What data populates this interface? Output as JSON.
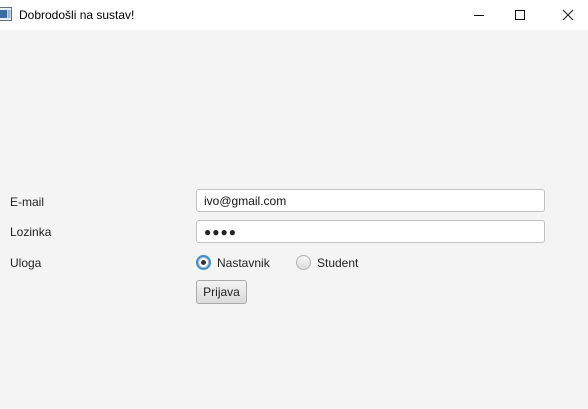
{
  "window": {
    "title": "Dobrodošli na sustav!",
    "controls": {
      "minimize_icon": "minimize-icon",
      "maximize_icon": "maximize-icon",
      "close_icon": "close-icon"
    }
  },
  "form": {
    "email_label": "E-mail",
    "email_value": "ivo@gmail.com",
    "password_label": "Lozinka",
    "password_mask": "●●●●",
    "role_label": "Uloga",
    "roles": [
      {
        "label": "Nastavnik",
        "selected": true
      },
      {
        "label": "Student",
        "selected": false
      }
    ],
    "submit_label": "Prijava"
  },
  "colors": {
    "background": "#f4f4f4",
    "titlebar": "#ffffff",
    "radio_focus": "#3c8fcf"
  }
}
